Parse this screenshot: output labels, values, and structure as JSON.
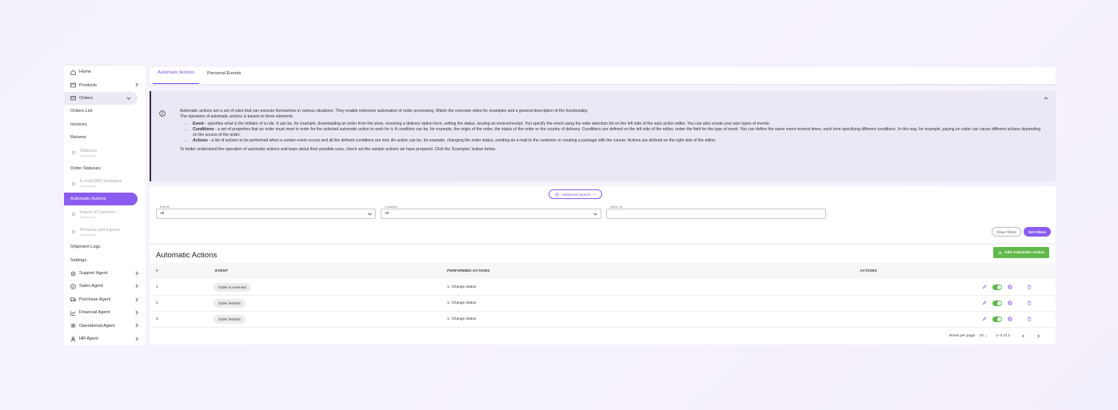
{
  "sidebar": {
    "items": [
      {
        "label": "Home",
        "icon": "home-icon"
      },
      {
        "label": "Products",
        "icon": "box-icon"
      },
      {
        "label": "Orders",
        "icon": "cart-icon"
      },
      {
        "label": "Orders List"
      },
      {
        "label": "Invoices"
      },
      {
        "label": "Returns"
      },
      {
        "label": "Statistics",
        "sub": "(coming soon)"
      },
      {
        "label": "Order Statuses"
      },
      {
        "label": "E-mail/SMS templates",
        "sub": "(coming soon)"
      },
      {
        "label": "Automatic Actions"
      },
      {
        "label": "Import of Transfers",
        "sub": "(coming soon)"
      },
      {
        "label": "Printouts and exports",
        "sub": "(coming soon)"
      },
      {
        "label": "Shipment Logs"
      },
      {
        "label": "Settings"
      },
      {
        "label": "Support Agent",
        "icon": "gear-icon"
      },
      {
        "label": "Sales Agent",
        "icon": "money-icon"
      },
      {
        "label": "Purchase Agent",
        "icon": "truck-icon"
      },
      {
        "label": "Financial Agent",
        "icon": "chart-icon"
      },
      {
        "label": "Operational Agent",
        "icon": "cog-icon"
      },
      {
        "label": "HR Agent",
        "icon": "user-icon"
      }
    ]
  },
  "tabs": [
    "Automatic Actions",
    "Personal Events"
  ],
  "info": {
    "intro": "Automatic actions are a set of rules that can execute themselves in various situations. They enable extensive automation of order processing. Watch the overview video for examples and a general description of the functionality.",
    "intro2": "The operation of automatic actions is based on three elements:",
    "event_title": "Event",
    "event_text": " - specifies what is the initiator of a rule. It can be, for example, downloading an order from the store, receiving a delivery option form, setting the status, issuing an invoice/receipt. You specify the event using the wide selection list on the left side of the auto action editor. You can also create your own types of events.",
    "cond_title": "Conditions",
    "cond_text": " - a set of properties that an order must meet in order for the selected automatic action to work for it. A condition can be, for example, the origin of the order, the status of the order or the country of delivery. Conditions are defined on the left side of the editor, under the field for the type of event. You can define the same event several times, each time specifying different conditions. In this way, for example, paying an order can cause different actions depending on the source of the order.",
    "act_title": "Actions",
    "act_text": " - a list of actions to be performed when a certain event occurs and all the defined conditions are met. An action can be, for example, changing the order status, sending an e-mail to the customer or creating a package with the courier. Actions are defined on the right side of the editor.",
    "outro": "To better understand the operation of automatic actions and learn about their possible uses, check out the sample actions we have prepared. Click the 'Examples' button below."
  },
  "filters": {
    "advanced_label": "Advanced Search",
    "events_label": "Events",
    "events_value": "All",
    "condition_label": "Condition",
    "condition_value": "All",
    "action_id_label": "Action ID",
    "clear_label": "Clear Filters",
    "set_label": "Set Filters"
  },
  "table": {
    "title": "Automatic Actions",
    "add_label": "Add Automatic Action",
    "headers": [
      "#",
      "EVENT",
      "PERFORMED ACTIONS",
      "ACTIONS"
    ],
    "rows": [
      {
        "num": "1",
        "event": "Order is reserved",
        "performed": "1. Change status"
      },
      {
        "num": "2",
        "event": "Order fetched",
        "performed": "1. Change status"
      },
      {
        "num": "3",
        "event": "Order fetched",
        "performed": "1. Change status"
      }
    ],
    "rows_per_page_label": "Rows per page:",
    "rows_per_page": "10",
    "range": "1–3 of 3"
  },
  "colors": {
    "accent": "#8a5cf0",
    "green": "#62b94b"
  }
}
